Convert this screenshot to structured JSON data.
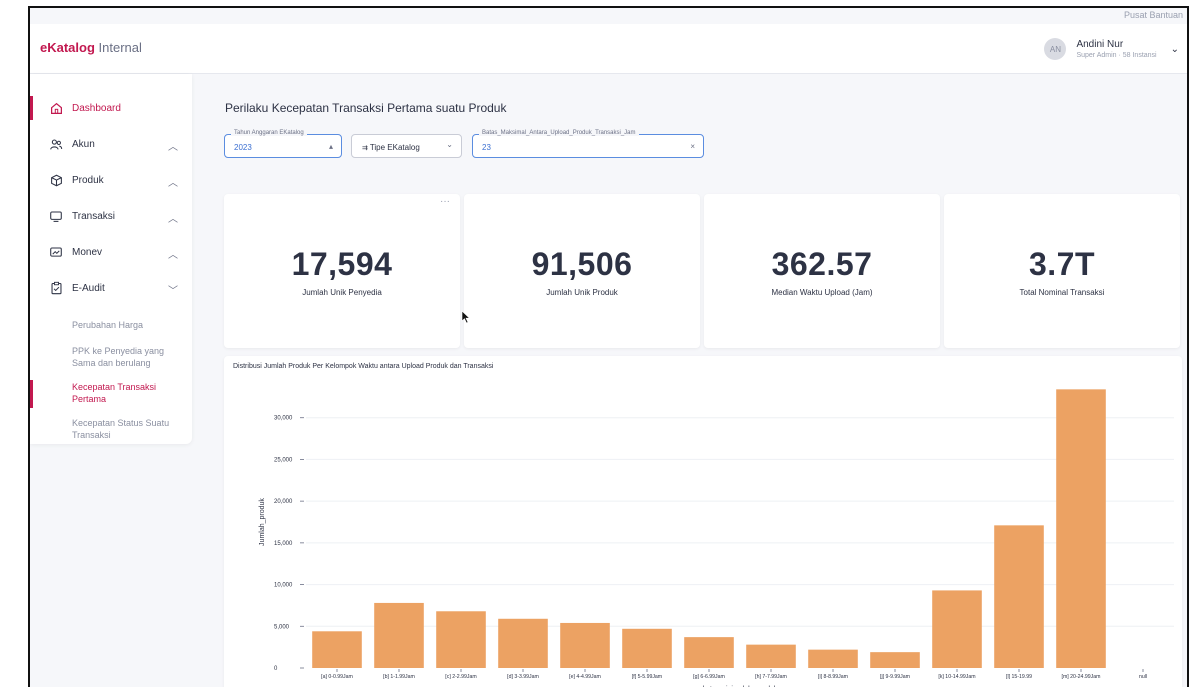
{
  "header": {
    "help_link": "Pusat Bantuan",
    "brand_bold": "eKatalog",
    "brand_light": " Internal",
    "user_initials": "AN",
    "user_name": "Andini Nur",
    "user_role": "Super Admin · 58 Instansi"
  },
  "sidebar": {
    "items": [
      {
        "label": "Dashboard",
        "icon": "home-icon",
        "active": true
      },
      {
        "label": "Akun",
        "icon": "users-icon",
        "chevron": "up"
      },
      {
        "label": "Produk",
        "icon": "box-icon",
        "chevron": "up"
      },
      {
        "label": "Transaksi",
        "icon": "monitor-icon",
        "chevron": "up"
      },
      {
        "label": "Monev",
        "icon": "chart-window-icon",
        "chevron": "up"
      },
      {
        "label": "E-Audit",
        "icon": "clipboard-check-icon",
        "chevron": "down"
      }
    ],
    "subitems": [
      {
        "label": "Perubahan Harga"
      },
      {
        "label": "PPK ke Penyedia yang Sama dan berulang"
      },
      {
        "label": "Kecepatan Transaksi Pertama",
        "active": true
      },
      {
        "label": "Kecepatan Status Suatu Transaksi"
      }
    ]
  },
  "page": {
    "title": "Perilaku Kecepatan Transaksi Pertama suatu Produk"
  },
  "filters": [
    {
      "label": "Tahun Anggaran EKatalog",
      "value": "2023",
      "control": "▴"
    },
    {
      "label": "",
      "value": "Tipe EKatalog",
      "control": "⌄"
    },
    {
      "label": "Batas_Maksimal_Antara_Upload_Produk_Transaksi_Jam",
      "value": "23",
      "control": "×"
    }
  ],
  "kpis": [
    {
      "value": "17,594",
      "label": "Jumlah Unik Penyedia"
    },
    {
      "value": "91,506",
      "label": "Jumlah Unik Produk"
    },
    {
      "value": "362.57",
      "label": "Median Waktu Upload (Jam)"
    },
    {
      "value": "3.7T",
      "label": "Total Nominal Transaksi"
    }
  ],
  "chart_data": {
    "type": "bar",
    "title": "Distribusi Jumlah Produk Per Kelompok Waktu antara Upload Produk dan Transaksi",
    "xlabel": "kategori_jumlah_produk",
    "ylabel": "Jumlah_produk",
    "ylim": [
      0,
      35000
    ],
    "yticks": [
      0,
      5000,
      10000,
      15000,
      20000,
      25000,
      30000
    ],
    "ytick_labels": [
      "0",
      "5,000",
      "10,000",
      "15,000",
      "20,000",
      "25,000",
      "30,000"
    ],
    "grid": true,
    "color": "#eca263",
    "categories": [
      "[a] 0-0.99Jam",
      "[b] 1-1.99Jam",
      "[c] 2-2.99Jam",
      "[d] 3-3.99Jam",
      "[e] 4-4.99Jam",
      "[f] 5-5.99Jam",
      "[g] 6-6.99Jam",
      "[h] 7-7.99Jam",
      "[i] 8-8.99Jam",
      "[j] 9-9.99Jam",
      "[k] 10-14.99Jam",
      "[l] 15-19.99",
      "[m] 20-24.99Jam",
      "null"
    ],
    "values": [
      4400,
      7800,
      6800,
      5900,
      5400,
      4700,
      3700,
      2800,
      2200,
      1900,
      9300,
      17100,
      33400,
      0
    ]
  }
}
